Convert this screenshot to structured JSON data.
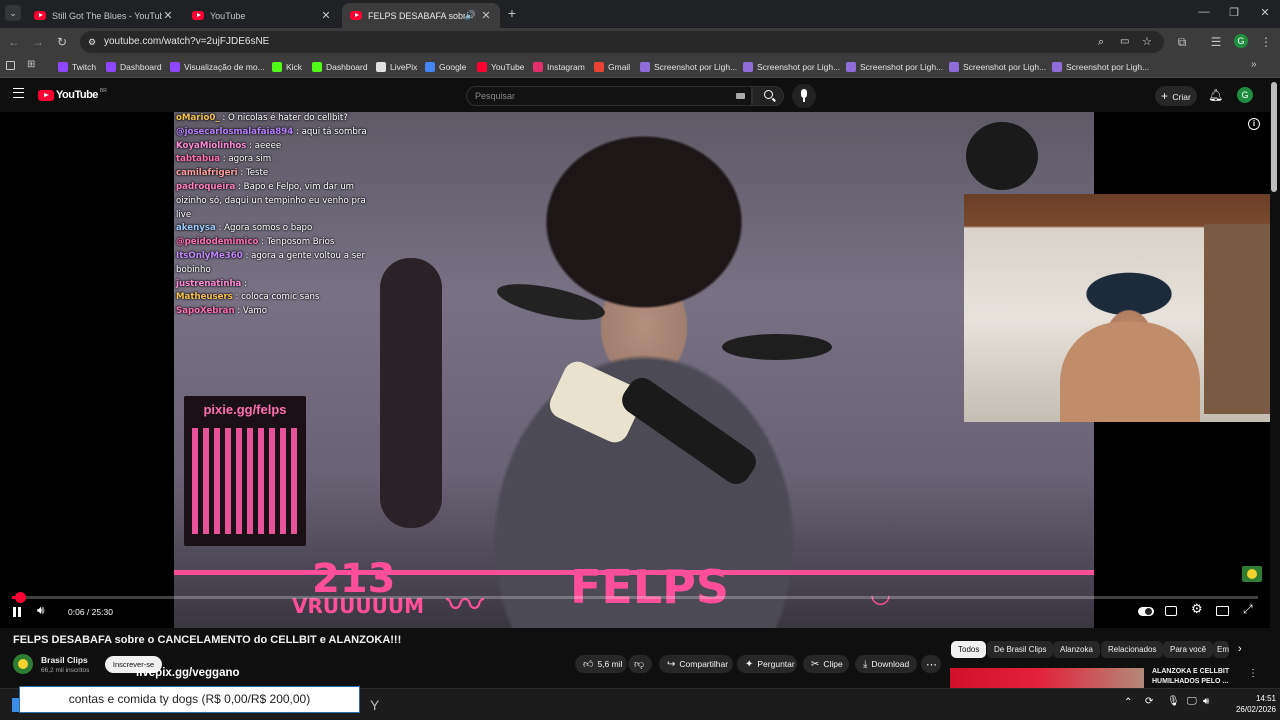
{
  "browser": {
    "tabs": [
      {
        "title": "Still Got The Blues - YouTube",
        "active": false
      },
      {
        "title": "YouTube",
        "active": false
      },
      {
        "title": "FELPS DESABAFA sobre o C",
        "active": true
      }
    ],
    "new_tab": "+",
    "url": "youtube.com/watch?v=2ujFJDE6sNE",
    "bookmarks": [
      {
        "label": "Twitch",
        "color": "#9146ff"
      },
      {
        "label": "Dashboard",
        "color": "#9146ff"
      },
      {
        "label": "Visualização de mo...",
        "color": "#9146ff"
      },
      {
        "label": "Kick",
        "color": "#53fc18"
      },
      {
        "label": "Dashboard",
        "color": "#53fc18"
      },
      {
        "label": "LivePix",
        "color": "#e0e0e0"
      },
      {
        "label": "Google",
        "color": "#4285f4"
      },
      {
        "label": "YouTube",
        "color": "#ff0033"
      },
      {
        "label": "Instagram",
        "color": "#e1306c"
      },
      {
        "label": "Gmail",
        "color": "#ea4335"
      },
      {
        "label": "Screenshot por Ligh...",
        "color": "#8e6cd9"
      },
      {
        "label": "Screenshot por Ligh...",
        "color": "#8e6cd9"
      },
      {
        "label": "Screenshot por Ligh...",
        "color": "#8e6cd9"
      },
      {
        "label": "Screenshot por Ligh...",
        "color": "#8e6cd9"
      },
      {
        "label": "Screenshot por Ligh...",
        "color": "#8e6cd9"
      }
    ],
    "profile_initial": "G"
  },
  "youtube": {
    "logo_text": "YouTube",
    "logo_region": "BR",
    "search_placeholder": "Pesquisar",
    "create_label": "Criar",
    "avatar_initial": "G"
  },
  "player": {
    "chat": [
      {
        "user": "oMario0_",
        "color": "#f6c24a",
        "msg": " : O nicolas é hater do cellbit?"
      },
      {
        "user": "@josecarlosmalafaia894",
        "color": "#b580ff",
        "msg": " : aqui tá sombra"
      },
      {
        "user": "KoyaMiolinhos",
        "color": "#ff8ad8",
        "msg": " : aeeee"
      },
      {
        "user": "tabtabua",
        "color": "#ff6fb0",
        "msg": " : agora sim"
      },
      {
        "user": "camilafrigeri",
        "color": "#ff9e9e",
        "msg": " : Teste"
      },
      {
        "user": "padroqueira",
        "color": "#ff7fbf",
        "msg": " : Bapo e Felpo, vim dar um oizinho só, daqui un tempinho eu venho pra live"
      },
      {
        "user": "akenysa",
        "color": "#9ec9ff",
        "msg": " : Agora somos o bapo"
      },
      {
        "user": "@peidodemimico",
        "color": "#ff6fb0",
        "msg": " : Tenposom Brios"
      },
      {
        "user": "ItsOnlyMe360",
        "color": "#c48bff",
        "msg": " : agora a gente voltou a ser bobinho"
      },
      {
        "user": "justrenatinha",
        "color": "#ff8ad8",
        "msg": " :"
      },
      {
        "user": "Matheusers",
        "color": "#f6c24a",
        "msg": " : coloca comic sans"
      },
      {
        "user": "SapoXebran",
        "color": "#ff6fb0",
        "msg": " : Vamo"
      }
    ],
    "qr_label": "pixie.gg/felps",
    "banner_number": "213",
    "banner_sub": "VRUUUUUM",
    "banner_name": "FELPS",
    "time_current": "0:06",
    "time_total": "25:30",
    "progress": 0.004
  },
  "video": {
    "title": "FELPS DESABAFA sobre o CANCELAMENTO do CELLBIT e ALANZOKA!!!",
    "channel": "Brasil Clips",
    "subscribers": "66,2 mil inscritos",
    "subscribe_label": "Inscrever-se",
    "likes": "5,6 mil",
    "share_label": "Compartilhar",
    "ask_label": "Perguntar",
    "clip_label": "Clipe",
    "download_label": "Download",
    "description_overlay": "livepix.gg/veggano"
  },
  "chips": [
    "Todos",
    "De Brasil Clips",
    "Alanzoka",
    "Relacionados",
    "Para você",
    "Em"
  ],
  "recommendation": {
    "title": "ALANZOKA E CELLBIT HUMILHADOS PELO ..."
  },
  "overlay_notice": "contas e comida ty dogs (R$ 0,00/R$ 200,00)",
  "taskbar": {
    "time": "14:51",
    "date": "26/02/2026"
  }
}
